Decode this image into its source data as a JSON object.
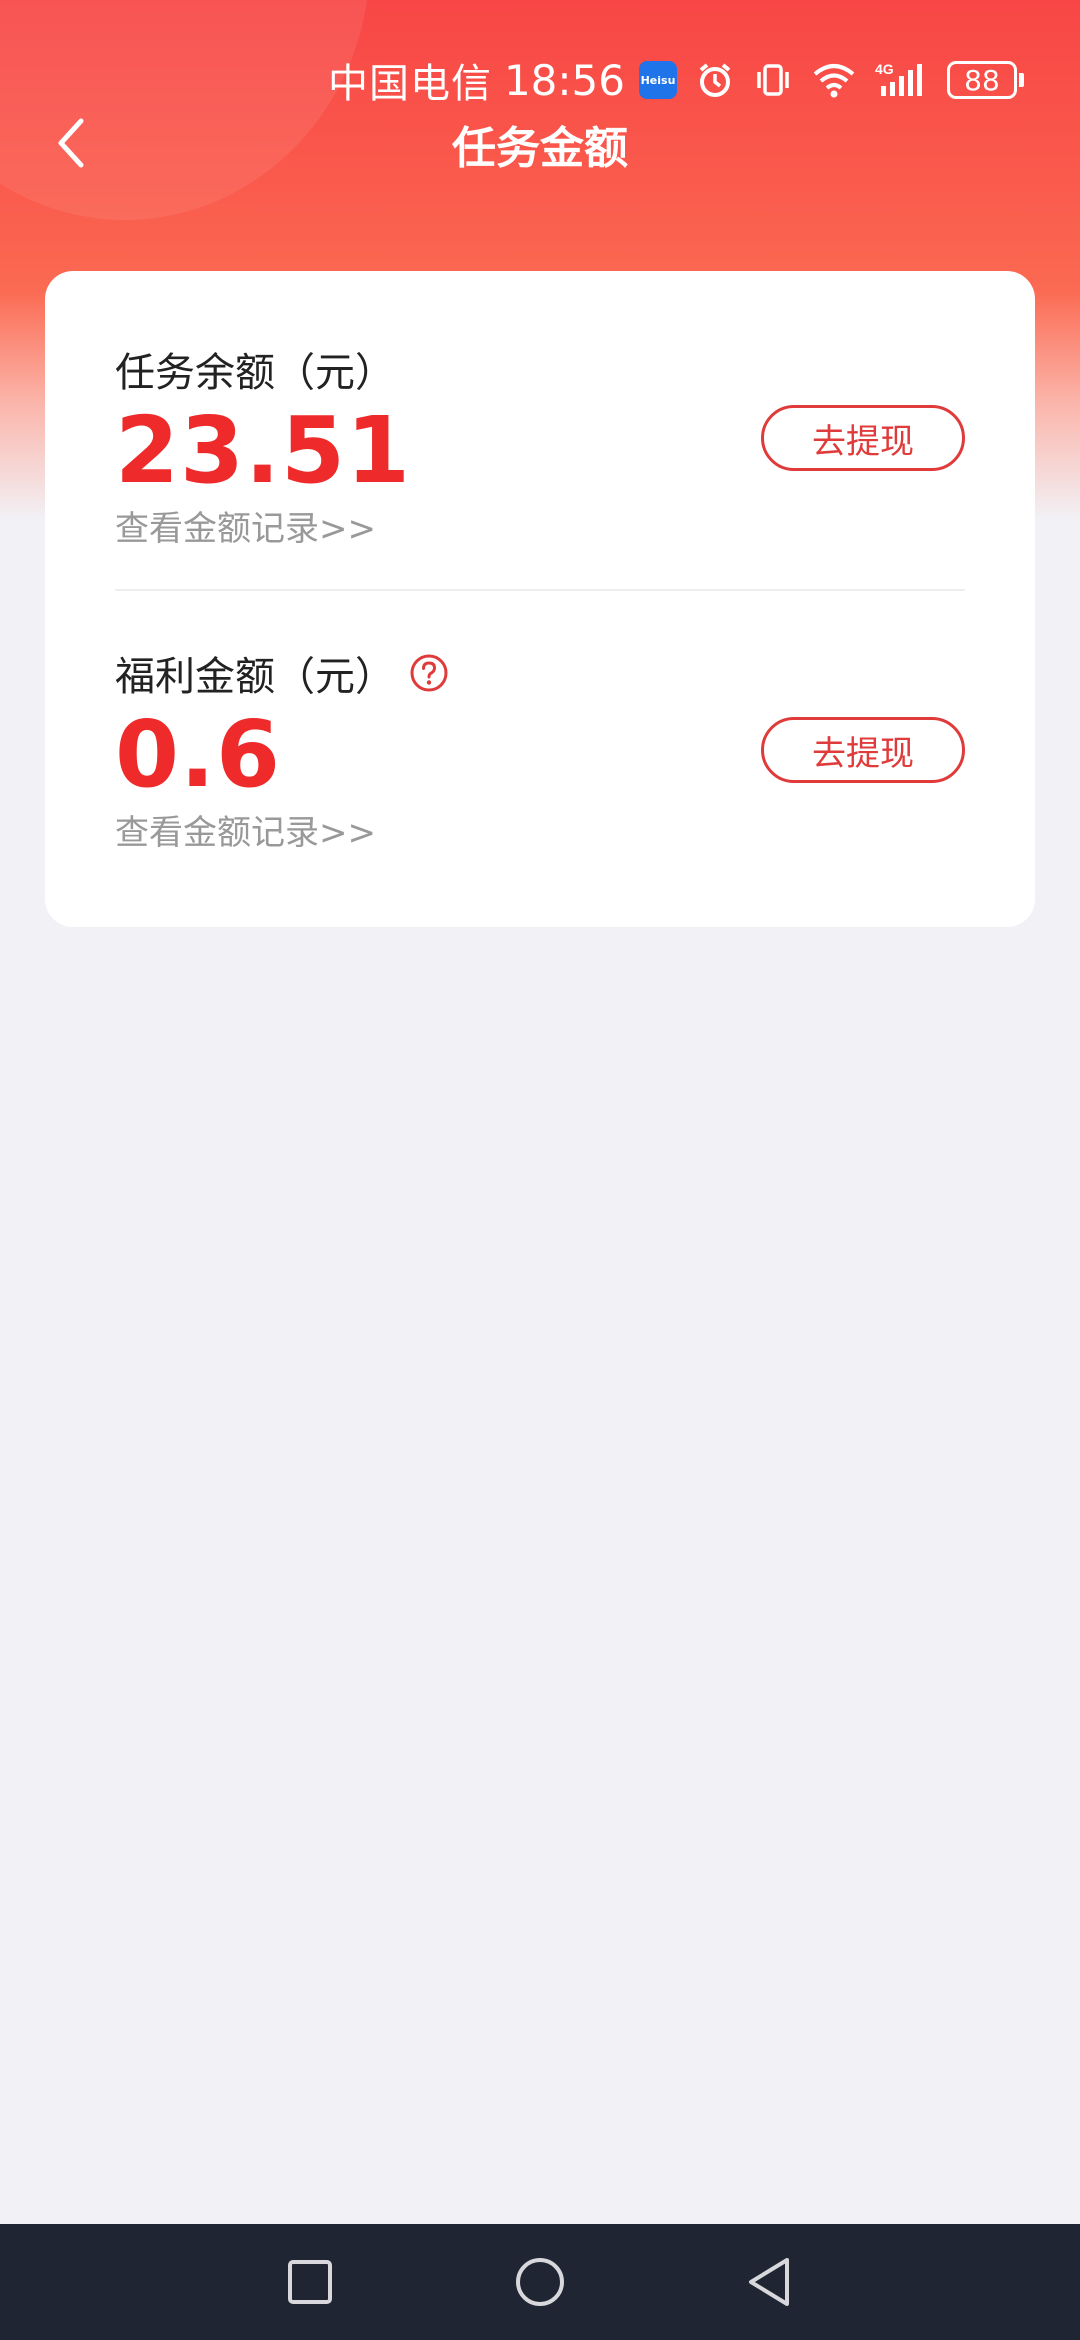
{
  "status_bar": {
    "carrier": "中国电信",
    "time": "18:56",
    "app_icon_text": "Heisu",
    "battery": "88"
  },
  "header": {
    "title": "任务金额"
  },
  "task_balance": {
    "label": "任务余额（元）",
    "amount": "23.51",
    "record_link": "查看金额记录>>",
    "button": "去提现"
  },
  "welfare_balance": {
    "label": "福利金额（元）",
    "amount": "0.6",
    "record_link": "查看金额记录>>",
    "button": "去提现"
  },
  "colors": {
    "accent_red": "#ee2a2a",
    "header_red": "#f84646",
    "page_bg": "#f2f1f6",
    "nav_bar": "#1f2532"
  },
  "icons": {
    "back": "chevron-left-icon",
    "help": "question-circle-icon",
    "nav_recent": "square-icon",
    "nav_home": "circle-icon",
    "nav_back": "triangle-left-icon"
  }
}
